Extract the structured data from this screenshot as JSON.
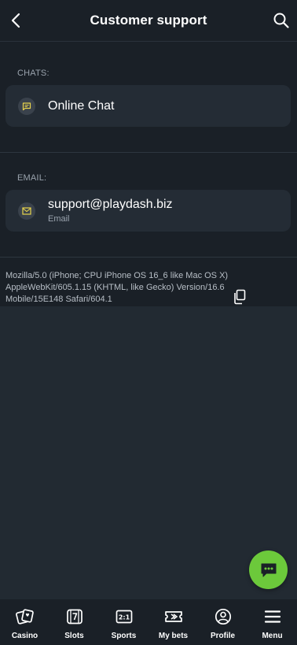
{
  "header": {
    "title": "Customer support"
  },
  "chats": {
    "label": "CHATS:",
    "items": [
      {
        "title": "Online Chat",
        "icon": "chat-bubble-icon"
      }
    ]
  },
  "email": {
    "label": "EMAIL:",
    "items": [
      {
        "title": "support@playdash.biz",
        "subtitle": "Email",
        "icon": "envelope-icon"
      }
    ]
  },
  "user_agent": "Mozilla/5.0 (iPhone; CPU iPhone OS 16_6 like Mac OS X) AppleWebKit/605.1.15 (KHTML, like Gecko) Version/16.6 Mobile/15E148 Safari/604.1",
  "colors": {
    "accent_yellow": "#e8d44d",
    "fab_green": "#6cc93b",
    "background": "#1a2027",
    "card": "#242c35"
  },
  "bottom_nav": [
    {
      "label": "Casino",
      "icon": "casino-cards-icon"
    },
    {
      "label": "Slots",
      "icon": "slots-seven-icon"
    },
    {
      "label": "Sports",
      "icon": "sports-score-icon"
    },
    {
      "label": "My bets",
      "icon": "ticket-icon"
    },
    {
      "label": "Profile",
      "icon": "profile-icon"
    },
    {
      "label": "Menu",
      "icon": "hamburger-menu-icon"
    }
  ]
}
